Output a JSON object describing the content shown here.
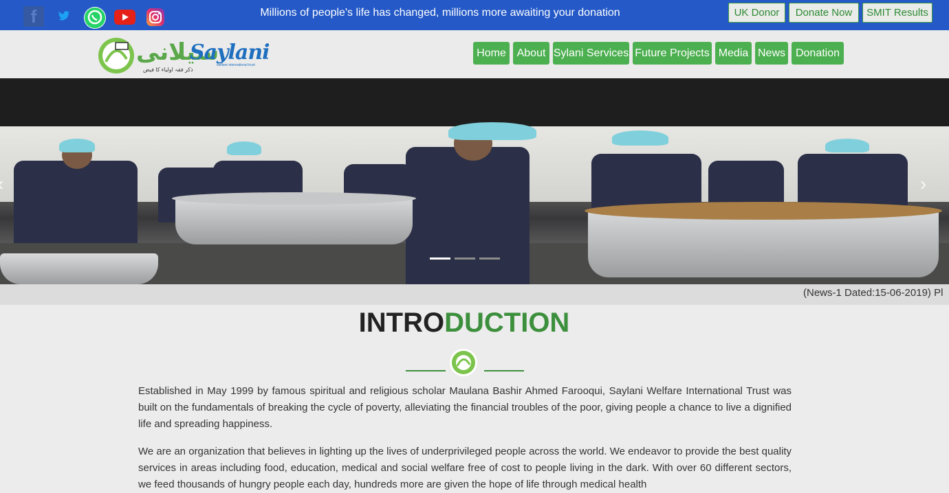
{
  "topbar": {
    "social": [
      {
        "name": "facebook-icon",
        "glyph": "f"
      },
      {
        "name": "twitter-icon",
        "glyph": "🐦"
      },
      {
        "name": "whatsapp-icon",
        "glyph": "✆"
      },
      {
        "name": "youtube-icon",
        "glyph": "▶"
      },
      {
        "name": "instagram-icon",
        "glyph": "◎"
      }
    ],
    "tagline": "Millions of people's life has changed, millions more awaiting your donation",
    "buttons": {
      "uk_donor": "UK Donor",
      "donate_now": "Donate Now",
      "smit_results": "SMIT Results"
    }
  },
  "header": {
    "logo_urdu": "سیلانی",
    "logo_en": "Saylani",
    "logo_sub": "welfare international trust",
    "logo_small": "ذکر فقہ اولیاء کا فیض",
    "nav": [
      "Home",
      "About",
      "Sylani Services",
      "Future Projects",
      "Media",
      "News",
      "Donation"
    ]
  },
  "hero": {
    "prev_arrow": "‹",
    "next_arrow": "›",
    "slides": 3,
    "active_slide": 1
  },
  "marquee": {
    "text": "(News-1 Dated:15-06-2019) Pl"
  },
  "intro": {
    "title_part1": "INTRO",
    "title_part2": "DUCTION",
    "paragraph1": "Established in May 1999 by famous spiritual and religious scholar Maulana Bashir Ahmed Farooqui, Saylani Welfare International Trust was built on the fundamentals of breaking the cycle of poverty, alleviating the financial troubles of the poor, giving people a chance to live a dignified life and spreading happiness.",
    "paragraph2": "We are an organization that believes in lighting up the lives of underprivileged people across the world. We endeavor to provide the best quality services in areas including food, education, medical and social welfare free of cost to people living in the dark. With over 60 different sectors, we feed thousands of hungry people each day, hundreds more are given the hope of life through medical health"
  },
  "colors": {
    "topbar": "#2459c7",
    "nav_green": "#4caf50",
    "title_green": "#3c8f3c"
  }
}
